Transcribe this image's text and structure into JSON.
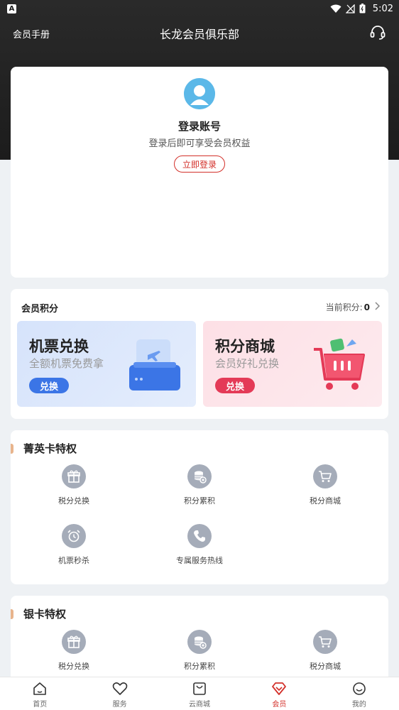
{
  "status_bar": {
    "time": "5:02",
    "app_letter": "A"
  },
  "header": {
    "left_link": "会员手册",
    "title": "长龙会员俱乐部"
  },
  "login": {
    "title": "登录账号",
    "subtitle": "登录后即可享受会员权益",
    "button": "立即登录"
  },
  "points": {
    "title": "会员积分",
    "current_label": "当前积分:",
    "current_value": "0",
    "promos": [
      {
        "title": "机票兑换",
        "subtitle": "全额机票免费拿",
        "button": "兑换"
      },
      {
        "title": "积分商城",
        "subtitle": "会员好礼兑换",
        "button": "兑换"
      }
    ]
  },
  "privileges": [
    {
      "title": "菁英卡特权",
      "items": [
        {
          "label": "税分兑换",
          "icon": "gift-icon"
        },
        {
          "label": "积分累积",
          "icon": "coins-icon"
        },
        {
          "label": "税分商城",
          "icon": "cart-icon"
        },
        {
          "label": "机票秒杀",
          "icon": "alarm-clock-icon"
        },
        {
          "label": "专属服务热线",
          "icon": "phone-icon"
        }
      ]
    },
    {
      "title": "银卡特权",
      "items": [
        {
          "label": "税分兑换",
          "icon": "gift-icon"
        },
        {
          "label": "积分累积",
          "icon": "coins-icon"
        },
        {
          "label": "税分商城",
          "icon": "cart-icon"
        }
      ]
    }
  ],
  "tabbar": [
    {
      "label": "首页",
      "icon": "home-icon",
      "active": false
    },
    {
      "label": "服务",
      "icon": "heart-icon",
      "active": false
    },
    {
      "label": "云商城",
      "icon": "shopping-bag-icon",
      "active": false
    },
    {
      "label": "会员",
      "icon": "diamond-icon",
      "active": true
    },
    {
      "label": "我的",
      "icon": "smiley-icon",
      "active": false
    }
  ],
  "colors": {
    "accent": "#d3302a",
    "ticket_blue": "#3b75e6",
    "mall_pink": "#e43a57",
    "hero_dark": "#1c1c1c"
  }
}
